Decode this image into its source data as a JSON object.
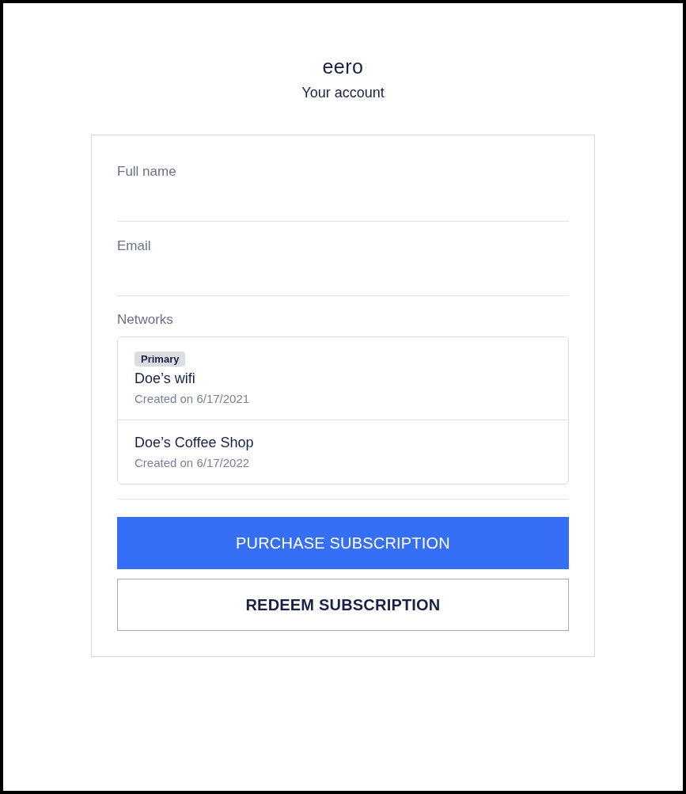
{
  "header": {
    "logo": "eero",
    "title": "Your account"
  },
  "fields": [
    {
      "label": "Full name"
    },
    {
      "label": "Email"
    }
  ],
  "networks": {
    "label": "Networks",
    "items": [
      {
        "badge": "Primary",
        "name": "Doe’s wifi",
        "created": "Created on 6/17/2021"
      },
      {
        "name": "Doe’s Coffee Shop",
        "created": "Created on 6/17/2022"
      }
    ]
  },
  "buttons": [
    {
      "kind": "primary",
      "label": "PURCHASE SUBSCRIPTION"
    },
    {
      "kind": "outline",
      "label": "REDEEM SUBSCRIPTION"
    }
  ]
}
